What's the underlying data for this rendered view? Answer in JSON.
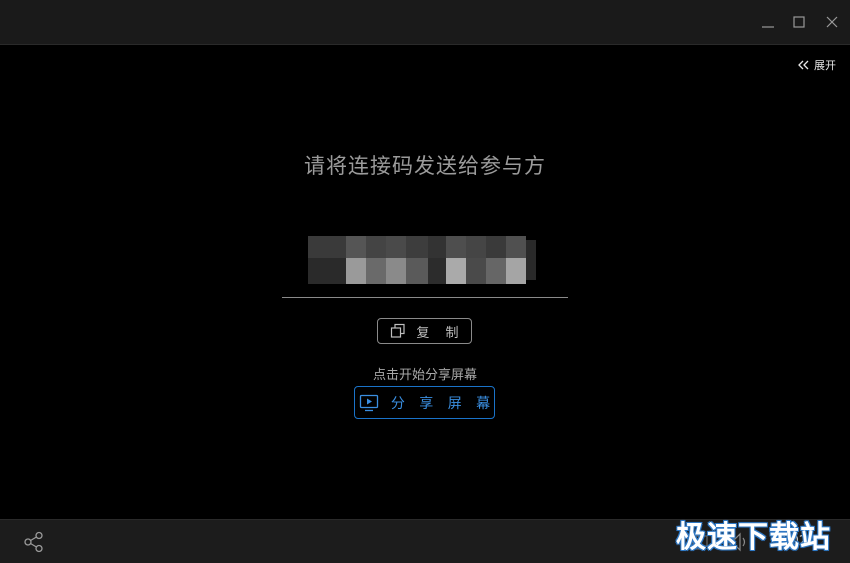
{
  "expand_toggle": {
    "label": "展开"
  },
  "main": {
    "prompt": "请将连接码发送给参与方",
    "copy_button": {
      "label": "复 制"
    },
    "share_hint": "点击开始分享屏幕",
    "share_button": {
      "label": "分 享 屏 幕"
    }
  },
  "bottom": {
    "time": "0:02"
  },
  "watermark": {
    "text": "极速下载站"
  },
  "colors": {
    "background": "#000000",
    "titlebar": "#1a1a1a",
    "accent_blue": "#1a73c9",
    "text_gray": "#9b9b9b"
  },
  "icons": {
    "minimize": "minimize-icon",
    "maximize": "maximize-icon",
    "close": "close-icon",
    "expand": "double-chevron-left-icon",
    "copy": "copy-icon",
    "screen": "screen-share-icon",
    "share": "share-icon",
    "speaker": "speaker-icon"
  }
}
